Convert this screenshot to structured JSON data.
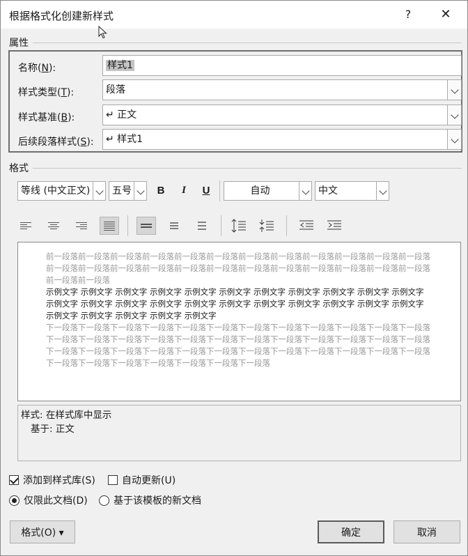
{
  "window": {
    "title": "根据格式化创建新样式",
    "help": "?",
    "close": "✕"
  },
  "properties": {
    "section_label": "属性",
    "name_label": "名称(N):",
    "name_value": "样式1",
    "type_label": "样式类型(T):",
    "type_value": "段落",
    "base_label": "样式基准(B):",
    "base_value": "↵ 正文",
    "next_label": "后续段落样式(S):",
    "next_value": "↵ 样式1"
  },
  "format": {
    "section_label": "格式",
    "font_family": "等线 (中文正文)",
    "font_size": "五号",
    "bold": "B",
    "italic": "I",
    "underline": "U",
    "color": "自动",
    "language": "中文"
  },
  "preview": {
    "prev_para": "前一段落前一段落前一段落前一段落前一段落前一段落前一段落前一段落前一段落前一段落前一段落前一段落前一段落前一段落前一段落前一段落前一段落前一段落前一段落前一段落前一段落前一段落前一段落前一段落前一段落前一段落",
    "sample": "示例文字 示例文字 示例文字 示例文字 示例文字 示例文字 示例文字 示例文字 示例文字 示例文字 示例文字 示例文字 示例文字 示例文字 示例文字 示例文字 示例文字 示例文字 示例文字 示例文字 示例文字 示例文字 示例文字 示例文字 示例文字 示例文字 示例文字",
    "next_para": "下一段落下一段落下一段落下一段落下一段落下一段落下一段落下一段落下一段落下一段落下一段落下一段落下一段落下一段落下一段落下一段落下一段落下一段落下一段落下一段落下一段落下一段落下一段落下一段落下一段落下一段落下一段落下一段落下一段落下一段落下一段落下一段落下一段落下一段落下一段落下一段落下一段落下一段落下一段落下一段落下一段落下一段落下一段落"
  },
  "description": {
    "line1": "样式: 在样式库中显示",
    "line2": "基于: 正文"
  },
  "options": {
    "add_to_gallery": "添加到样式库(S)",
    "add_to_gallery_checked": true,
    "auto_update": "自动更新(U)",
    "auto_update_checked": false,
    "only_this_doc": "仅限此文档(D)",
    "new_docs_template": "基于该模板的新文档"
  },
  "buttons": {
    "format": "格式(O) ▾",
    "ok": "确定",
    "cancel": "取消"
  },
  "colors": {
    "dialog_bg": "#f0f0f0",
    "border_dark": "#6e6e6e",
    "preview_gray": "#9a9a9a"
  }
}
